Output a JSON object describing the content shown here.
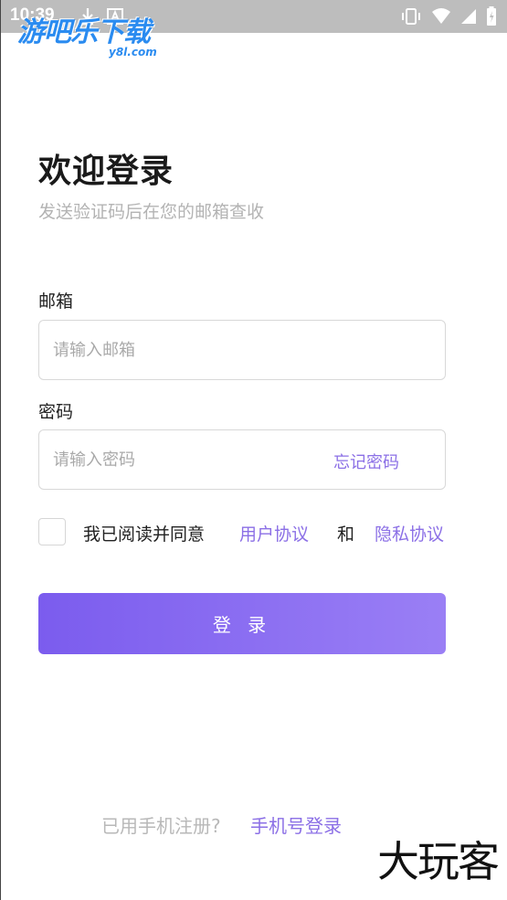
{
  "status_bar": {
    "time": "10:39"
  },
  "watermark": {
    "logo_text": "游吧乐下载",
    "logo_sub": "y8l.com",
    "corner_text": "大玩客"
  },
  "header": {
    "title": "欢迎登录",
    "subtitle": "发送验证码后在您的邮箱查收"
  },
  "form": {
    "email_label": "邮箱",
    "email_placeholder": "请输入邮箱",
    "email_value": "",
    "password_label": "密码",
    "password_placeholder": "请输入密码",
    "password_value": "",
    "forgot_label": "忘记密码"
  },
  "agreement": {
    "checked": false,
    "prefix": "我已阅读并同意",
    "user_agreement": "用户协议",
    "and": "和",
    "privacy_policy": "隐私协议"
  },
  "login_button": {
    "label": "登 录"
  },
  "footer": {
    "hint": "已用手机注册?",
    "phone_login": "手机号登录"
  },
  "colors": {
    "accent": "#8b6fe6",
    "button_start": "#7b5cee",
    "button_end": "#9a7ff5",
    "status_bar": "#bdbdbd"
  }
}
